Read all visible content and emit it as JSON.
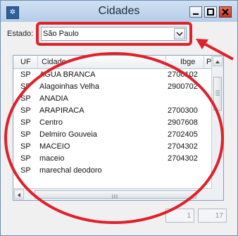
{
  "window": {
    "title": "Cidades",
    "app_icon": "app-icon"
  },
  "controls": {
    "min_icon": "minimize-icon",
    "max_icon": "maximize-icon",
    "close_icon": "close-icon"
  },
  "filter": {
    "label": "Estado:",
    "value": "São Paulo"
  },
  "grid": {
    "columns": [
      "UF",
      "Cidade",
      "Ibge",
      "P"
    ],
    "rows": [
      {
        "uf": "SP",
        "cidade": "AGUA BRANCA",
        "ibge": "2700102"
      },
      {
        "uf": "SP",
        "cidade": "Alagoinhas Velha",
        "ibge": "2900702"
      },
      {
        "uf": "SP",
        "cidade": "ANADIA",
        "ibge": ""
      },
      {
        "uf": "SP",
        "cidade": "ARAPIRACA",
        "ibge": "2700300"
      },
      {
        "uf": "SP",
        "cidade": "Centro",
        "ibge": "2907608"
      },
      {
        "uf": "SP",
        "cidade": "Delmiro Gouveia",
        "ibge": "2702405"
      },
      {
        "uf": "SP",
        "cidade": "MACEIO",
        "ibge": "2704302"
      },
      {
        "uf": "SP",
        "cidade": "maceio",
        "ibge": "2704302"
      },
      {
        "uf": "SP",
        "cidade": "marechal deodoro",
        "ibge": ""
      }
    ]
  },
  "pager": {
    "current": "1",
    "total": "17"
  },
  "colors": {
    "annotation": "#e0202a"
  }
}
